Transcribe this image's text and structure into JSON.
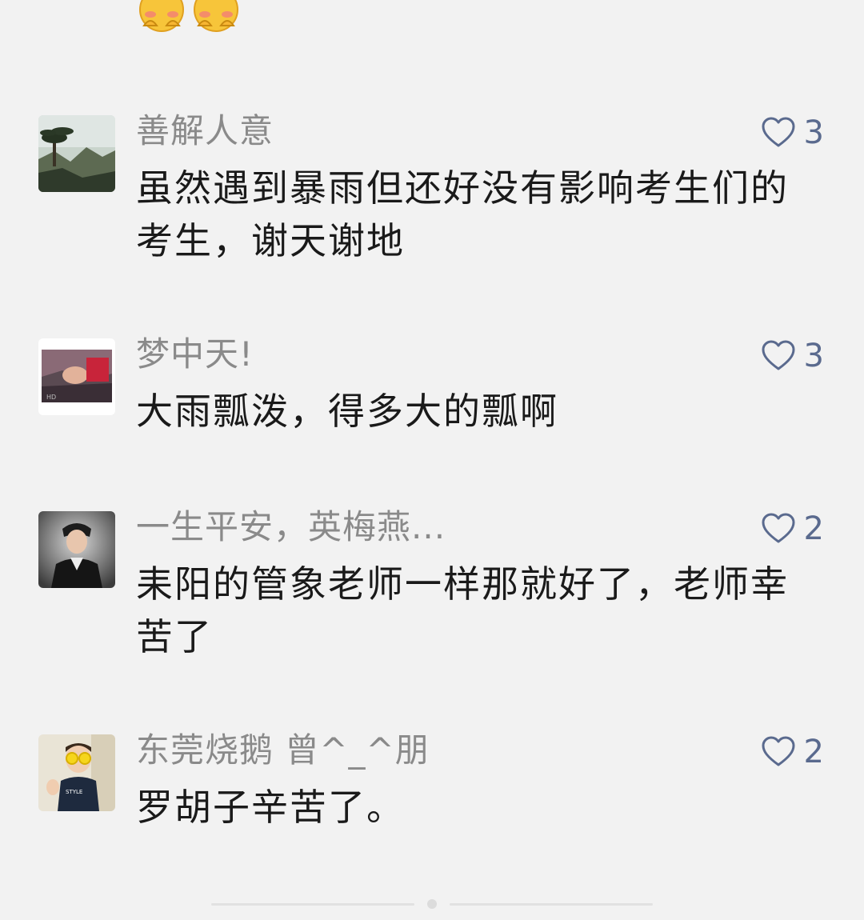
{
  "top_emojis": [
    "blushing-hands-emoji",
    "blushing-hands-emoji"
  ],
  "comments": [
    {
      "avatar": "landscape-pine-tree-avatar",
      "name": "善解人意",
      "likes": "3",
      "text": "虽然遇到暴雨但还好没有影响考生们的考生，谢天谢地"
    },
    {
      "avatar": "person-lying-avatar",
      "name": "梦中天!",
      "likes": "3",
      "text": "大雨瓢泼，得多大的瓢啊"
    },
    {
      "avatar": "man-black-jacket-avatar",
      "name": "一生平安，英梅燕...",
      "likes": "2",
      "text": "耒阳的管象老师一样那就好了，老师幸苦了"
    },
    {
      "avatar": "child-yellow-glasses-avatar",
      "name": "东莞烧鹅 曾^_^朋",
      "likes": "2",
      "text": "罗胡子辛苦了。"
    }
  ],
  "colors": {
    "background": "#f2f2f2",
    "name": "#8a8a8a",
    "text": "#1a1a1a",
    "like": "#5a6a8e"
  }
}
